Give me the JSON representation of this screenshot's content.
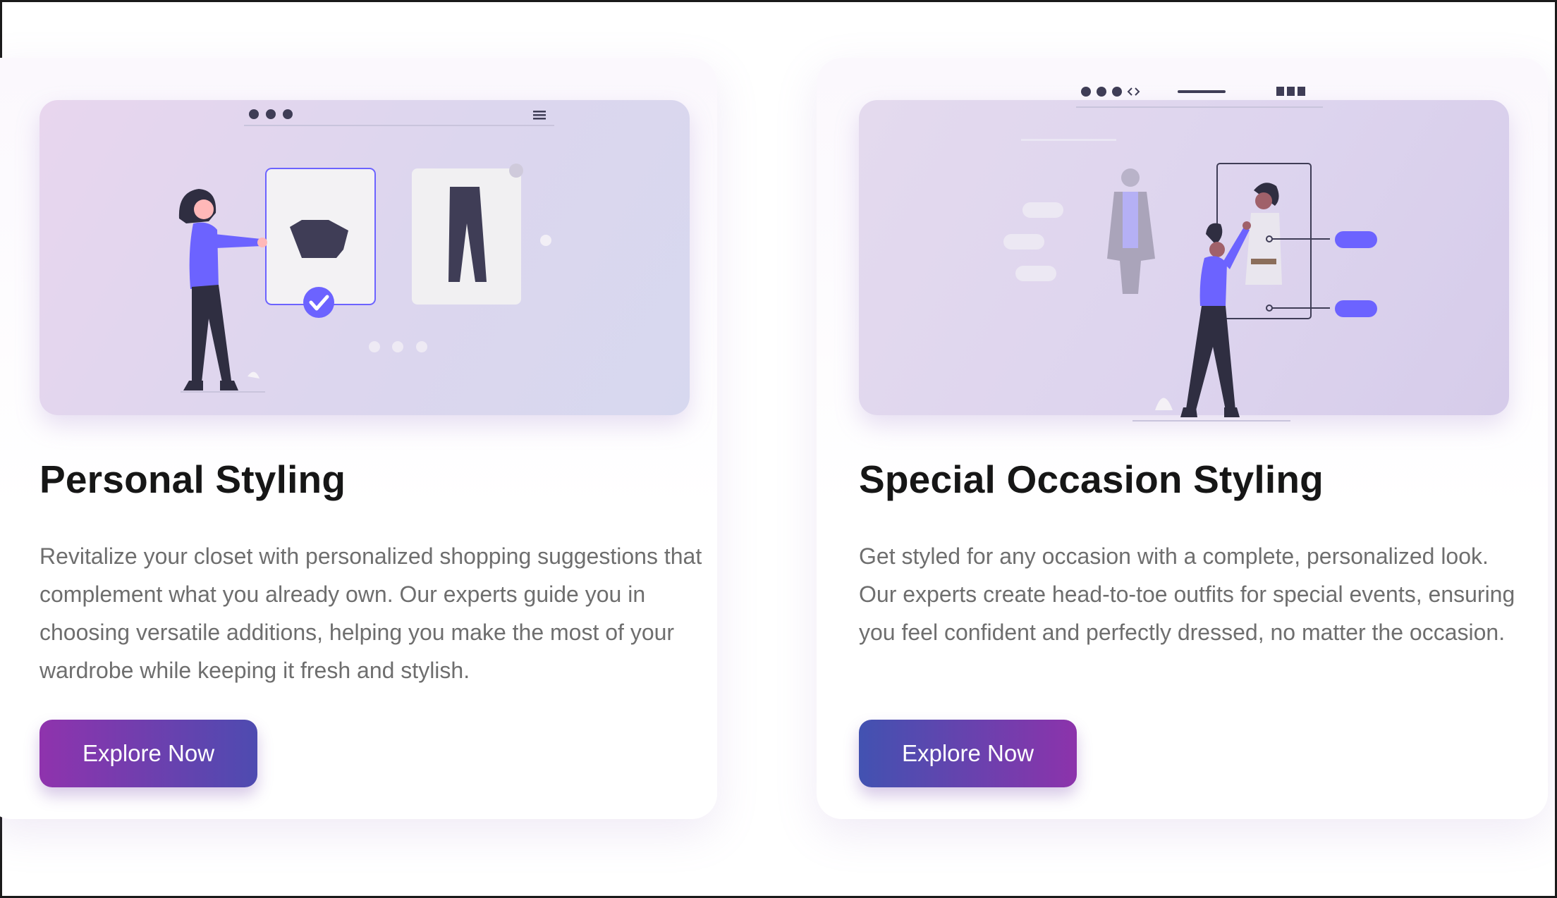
{
  "cards": [
    {
      "title": "Personal Styling",
      "description": "Revitalize your closet with personalized shopping suggestions that complement what you already own. Our experts guide you in choosing versatile additions, helping you make the most of your wardrobe while keeping it fresh and stylish.",
      "button_label": "Explore Now",
      "illustration_icon": "personal-styling-illustration-icon"
    },
    {
      "title": "Special Occasion Styling",
      "description": "Get styled for any occasion with a complete, personalized look. Our experts create head-to-toe outfits for special events, ensuring you feel confident and perfectly dressed, no matter the occasion.",
      "button_label": "Explore Now",
      "illustration_icon": "occasion-styling-illustration-icon"
    }
  ],
  "colors": {
    "accent": "#6c63ff",
    "button_gradient_a": "#8f33ad",
    "button_gradient_b": "#4e4bb0",
    "title": "#161616",
    "body_text": "#6e6e6e"
  }
}
